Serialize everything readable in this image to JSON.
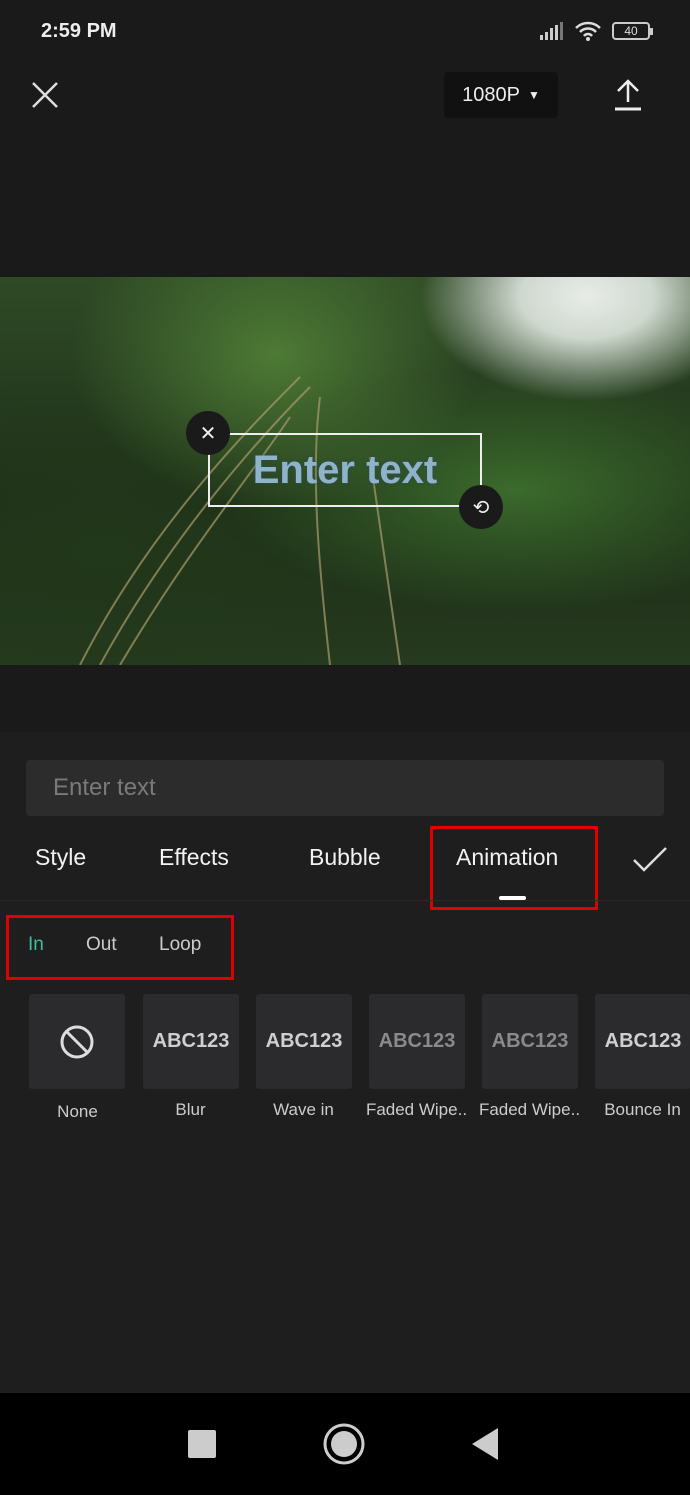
{
  "status": {
    "time": "2:59 PM",
    "battery": "40"
  },
  "toolbar": {
    "resolution": "1080P"
  },
  "preview": {
    "overlay_text": "Enter text"
  },
  "editor": {
    "placeholder": "Enter text",
    "tabs": [
      "Style",
      "Effects",
      "Bubble",
      "Animation"
    ],
    "active_tab": "Animation",
    "subtabs": [
      "In",
      "Out",
      "Loop"
    ],
    "active_subtab": "In",
    "presets": [
      {
        "label": "None",
        "preview": ""
      },
      {
        "label": "Blur",
        "preview": "ABC123"
      },
      {
        "label": "Wave in",
        "preview": "ABC123"
      },
      {
        "label": "Faded Wipe..",
        "preview": "ABC123"
      },
      {
        "label": "Faded Wipe..",
        "preview": "ABC123"
      },
      {
        "label": "Bounce In",
        "preview": "ABC123"
      }
    ]
  },
  "colors": {
    "accent": "#3fbfa0",
    "highlight_box": "#e00000"
  }
}
